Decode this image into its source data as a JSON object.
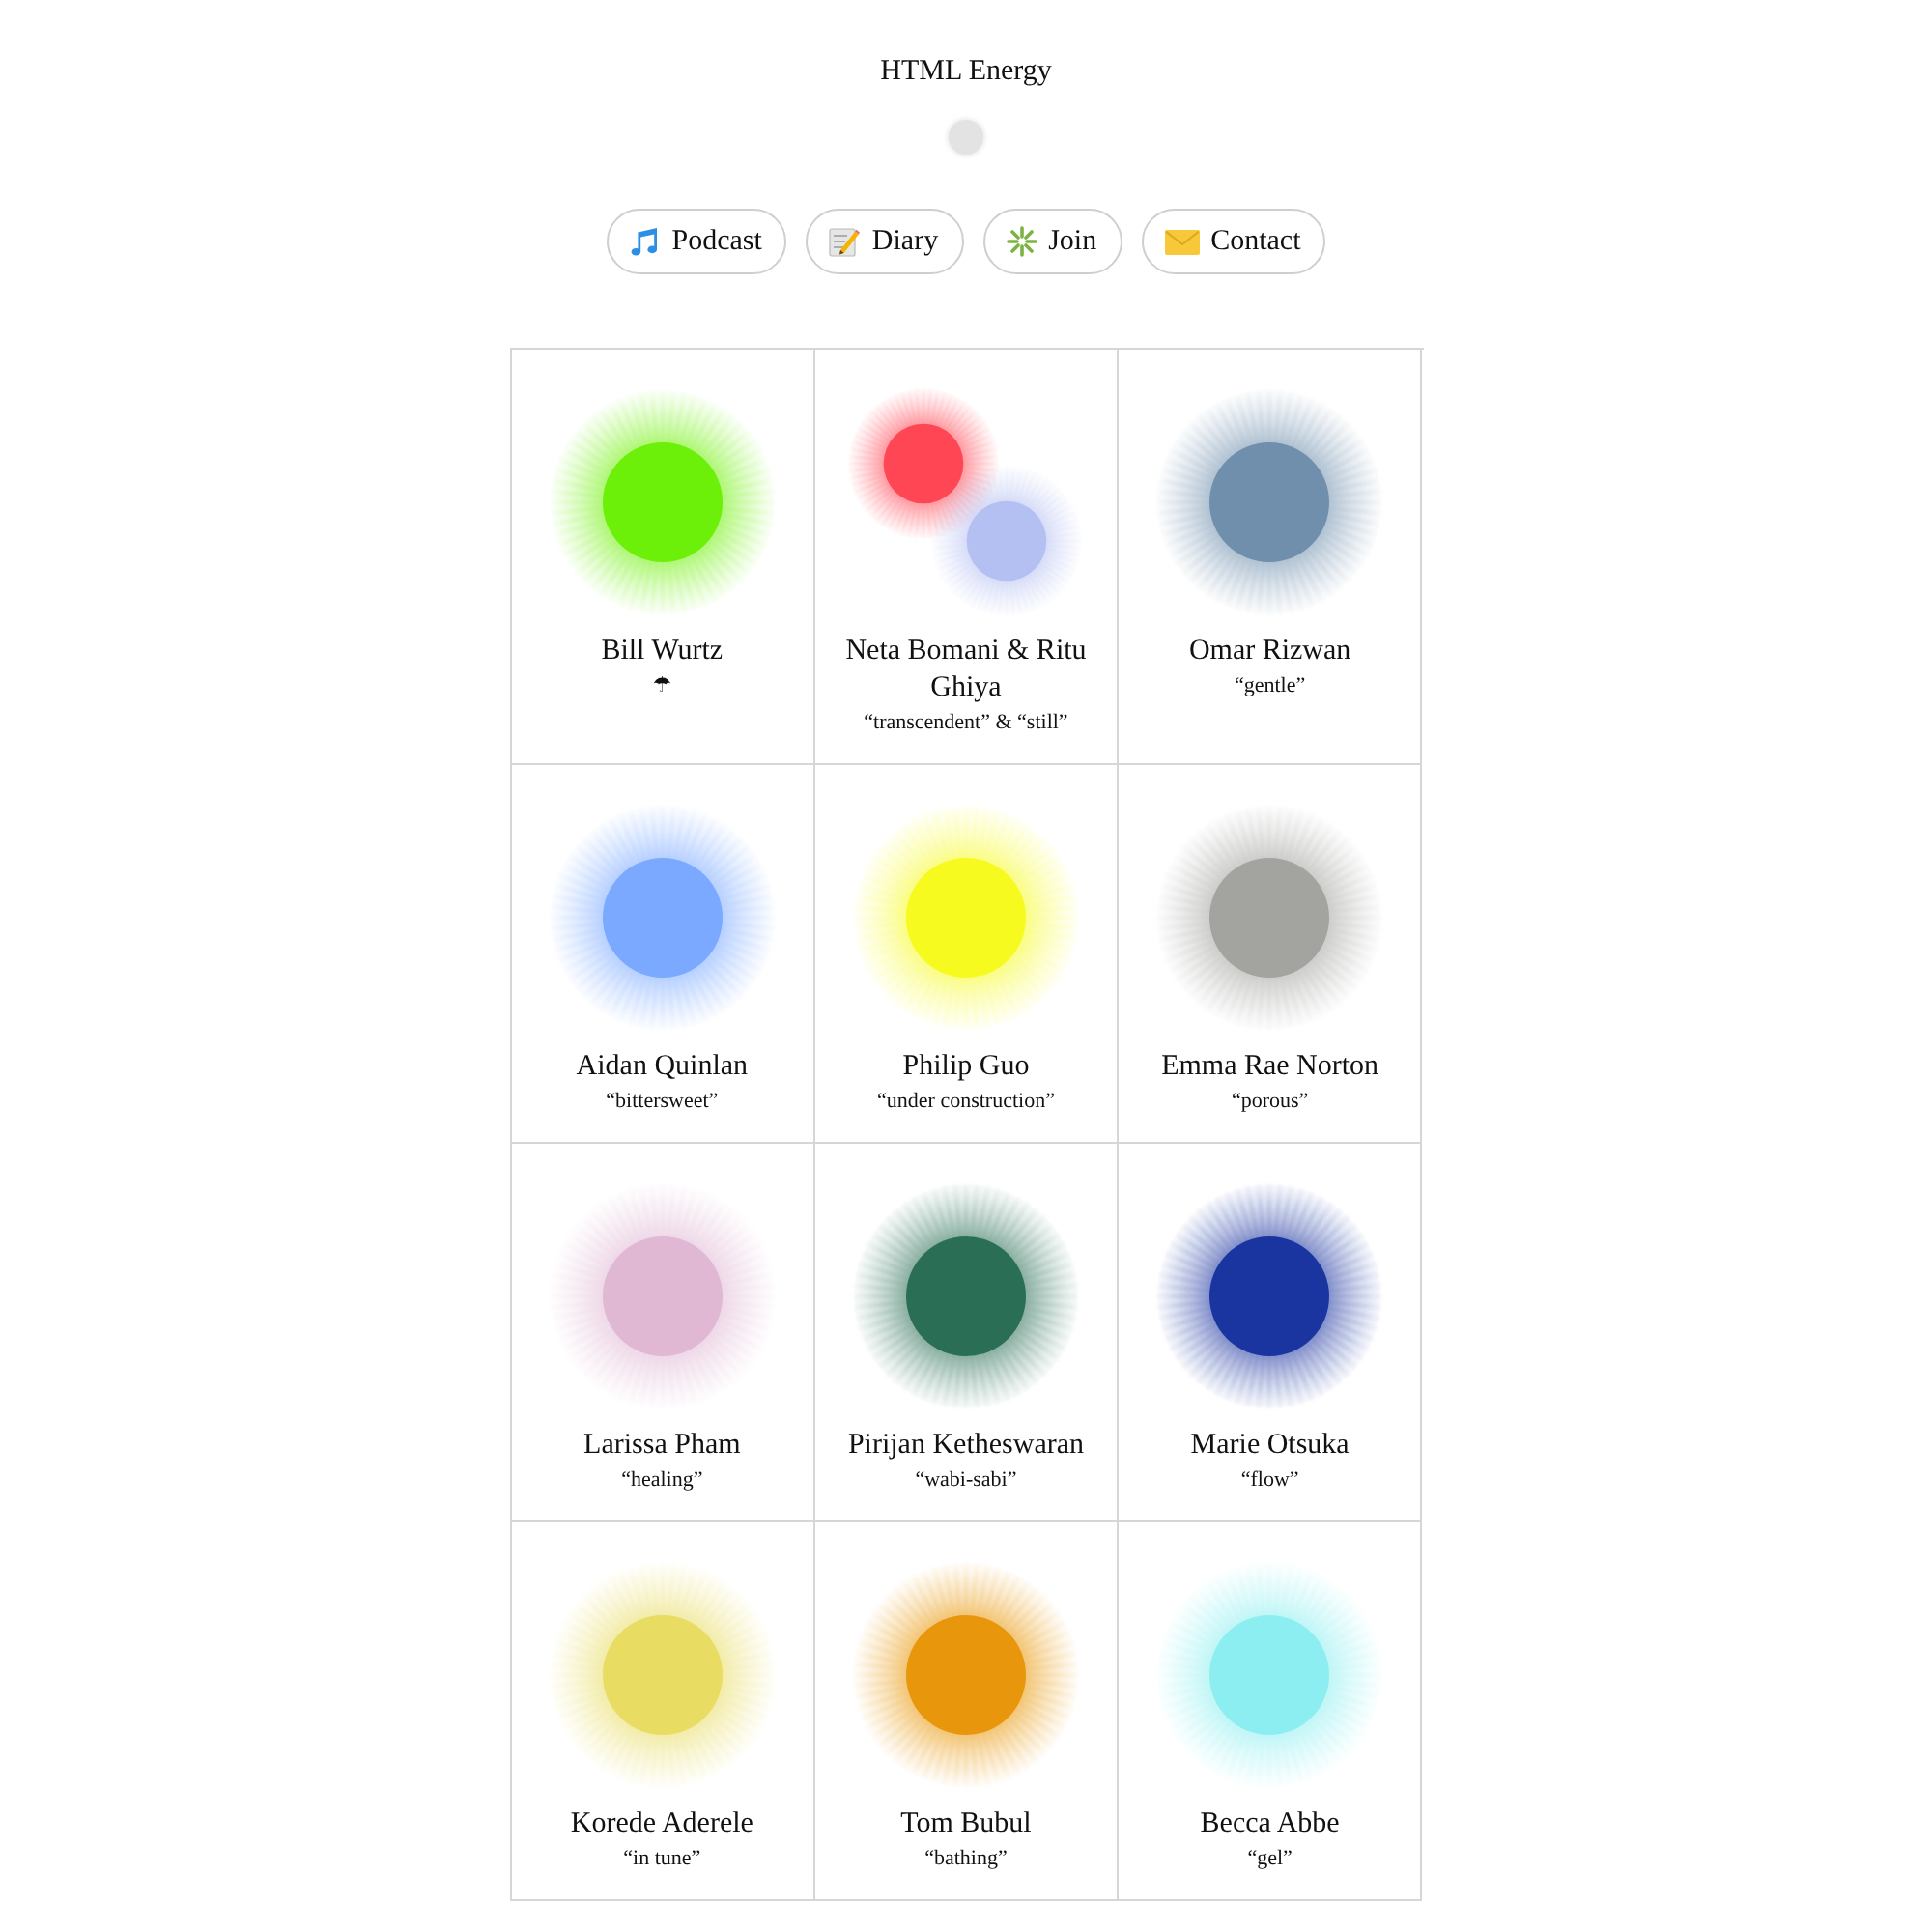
{
  "site": {
    "title": "HTML Energy"
  },
  "nav": [
    {
      "label": "Podcast"
    },
    {
      "label": "Diary"
    },
    {
      "label": "Join"
    },
    {
      "label": "Contact"
    }
  ],
  "projects": [
    {
      "name": "Bill Wurtz",
      "tagline": "☂",
      "orbs": [
        {
          "color": "#6cf00a"
        }
      ]
    },
    {
      "name": "Neta Bomani & Ritu Ghiya",
      "tagline": "“transcendent” & “still”",
      "orbs": [
        {
          "color": "#ff4654"
        },
        {
          "color": "#b5c0f2"
        }
      ]
    },
    {
      "name": "Omar Rizwan",
      "tagline": "“gentle”",
      "orbs": [
        {
          "color": "#6f8fad"
        }
      ]
    },
    {
      "name": "Aidan Quinlan",
      "tagline": "“bittersweet”",
      "orbs": [
        {
          "color": "#7aa9ff"
        }
      ]
    },
    {
      "name": "Philip Guo",
      "tagline": "“under construction”",
      "orbs": [
        {
          "color": "#f6fa1e"
        }
      ]
    },
    {
      "name": "Emma Rae Norton",
      "tagline": "“porous”",
      "orbs": [
        {
          "color": "#a3a4a0"
        }
      ]
    },
    {
      "name": "Larissa Pham",
      "tagline": "“healing”",
      "orbs": [
        {
          "color": "#e0b8d4"
        }
      ]
    },
    {
      "name": "Pirijan Ketheswaran",
      "tagline": "“wabi-sabi”",
      "orbs": [
        {
          "color": "#2a6e55"
        }
      ]
    },
    {
      "name": "Marie Otsuka",
      "tagline": "“flow”",
      "orbs": [
        {
          "color": "#1a35a0"
        }
      ]
    },
    {
      "name": "Korede Aderele",
      "tagline": "“in tune”",
      "orbs": [
        {
          "color": "#e8dc62"
        }
      ]
    },
    {
      "name": "Tom Bubul",
      "tagline": "“bathing”",
      "orbs": [
        {
          "color": "#e8960c"
        }
      ]
    },
    {
      "name": "Becca Abbe",
      "tagline": "“gel”",
      "orbs": [
        {
          "color": "#8ceef0"
        }
      ]
    }
  ]
}
